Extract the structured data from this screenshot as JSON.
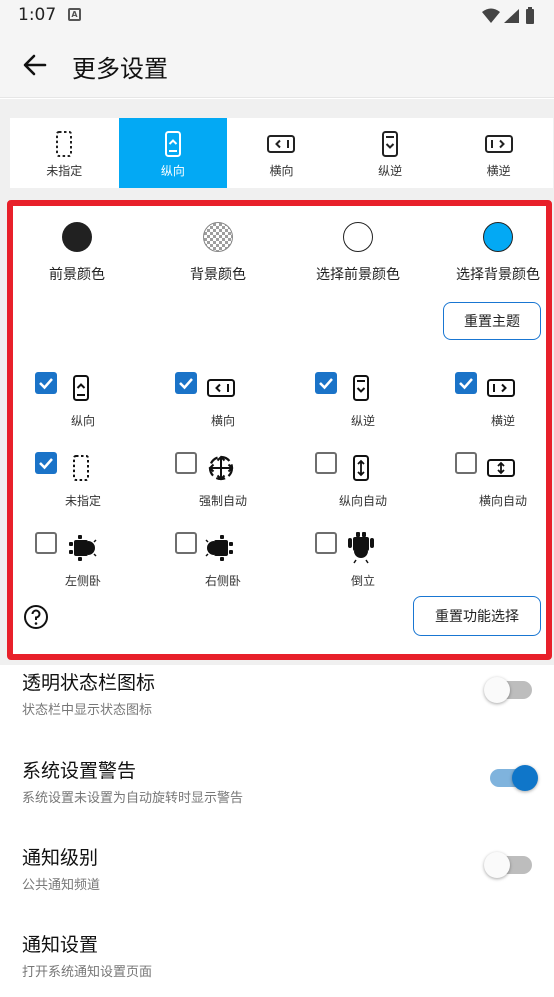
{
  "status_bar": {
    "time": "1:07",
    "notif_icon": "A"
  },
  "app_bar": {
    "title": "更多设置"
  },
  "orientation_tabs": [
    {
      "label": "未指定",
      "icon": "phone-dotted-icon"
    },
    {
      "label": "纵向",
      "icon": "phone-portrait-icon",
      "selected": true
    },
    {
      "label": "横向",
      "icon": "phone-landscape-icon"
    },
    {
      "label": "纵逆",
      "icon": "phone-reverse-portrait-icon"
    },
    {
      "label": "横逆",
      "icon": "phone-reverse-landscape-icon"
    }
  ],
  "colors": [
    {
      "label": "前景颜色",
      "color": "#212121"
    },
    {
      "label": "背景颜色",
      "color": "checker"
    },
    {
      "label": "选择前景颜色",
      "color": "#ffffff"
    },
    {
      "label": "选择背景颜色",
      "color": "#03a9f4"
    }
  ],
  "reset_theme_label": "重置主题",
  "features": [
    {
      "label": "纵向",
      "checked": true,
      "icon": "phone-portrait-icon"
    },
    {
      "label": "横向",
      "checked": true,
      "icon": "phone-landscape-icon"
    },
    {
      "label": "纵逆",
      "checked": true,
      "icon": "phone-reverse-portrait-icon"
    },
    {
      "label": "横逆",
      "checked": true,
      "icon": "phone-reverse-landscape-icon"
    },
    {
      "label": "未指定",
      "checked": true,
      "icon": "phone-dotted-icon"
    },
    {
      "label": "强制自动",
      "checked": false,
      "icon": "rotate-arrows-icon"
    },
    {
      "label": "纵向自动",
      "checked": false,
      "icon": "phone-vertical-auto-icon"
    },
    {
      "label": "横向自动",
      "checked": false,
      "icon": "phone-horizontal-auto-icon"
    },
    {
      "label": "左侧卧",
      "checked": false,
      "icon": "android-left-icon"
    },
    {
      "label": "右侧卧",
      "checked": false,
      "icon": "android-right-icon"
    },
    {
      "label": "倒立",
      "checked": false,
      "icon": "android-upside-down-icon"
    }
  ],
  "reset_features_label": "重置功能选择",
  "settings": [
    {
      "title": "透明状态栏图标",
      "subtitle": "状态栏中显示状态图标",
      "enabled": false
    },
    {
      "title": "系统设置警告",
      "subtitle": "系统设置未设置为自动旋转时显示警告",
      "enabled": true
    },
    {
      "title": "通知级别",
      "subtitle": "公共通知频道",
      "enabled": false
    },
    {
      "title": "通知设置",
      "subtitle": "打开系统通知设置页面"
    }
  ]
}
